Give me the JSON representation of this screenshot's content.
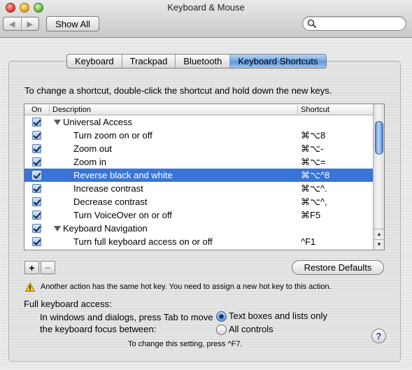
{
  "window": {
    "title": "Keyboard & Mouse"
  },
  "toolbar": {
    "back_icon": "◀",
    "forward_icon": "▶",
    "show_all_label": "Show All",
    "search_placeholder": ""
  },
  "tabs": [
    {
      "label": "Keyboard",
      "active": false
    },
    {
      "label": "Trackpad",
      "active": false
    },
    {
      "label": "Bluetooth",
      "active": false
    },
    {
      "label": "Keyboard Shortcuts",
      "active": true
    }
  ],
  "shortcuts": {
    "instructions": "To change a shortcut, double-click the shortcut and hold down the new keys.",
    "columns": {
      "on": "On",
      "description": "Description",
      "shortcut": "Shortcut"
    },
    "rows": [
      {
        "type": "group",
        "checked": true,
        "description": "Universal Access",
        "shortcut": ""
      },
      {
        "type": "item",
        "checked": true,
        "description": "Turn zoom on or off",
        "shortcut": "⌘⌥8"
      },
      {
        "type": "item",
        "checked": true,
        "description": "Zoom out",
        "shortcut": "⌘⌥-"
      },
      {
        "type": "item",
        "checked": true,
        "description": "Zoom in",
        "shortcut": "⌘⌥="
      },
      {
        "type": "item",
        "checked": true,
        "description": "Reverse black and white",
        "shortcut": "⌘⌥^8",
        "selected": true
      },
      {
        "type": "item",
        "checked": true,
        "description": "Increase contrast",
        "shortcut": "⌘⌥^."
      },
      {
        "type": "item",
        "checked": true,
        "description": "Decrease contrast",
        "shortcut": "⌘⌥^,"
      },
      {
        "type": "item",
        "checked": true,
        "description": "Turn VoiceOver on or off",
        "shortcut": "⌘F5"
      },
      {
        "type": "group",
        "checked": true,
        "description": "Keyboard Navigation",
        "shortcut": ""
      },
      {
        "type": "item",
        "checked": true,
        "description": "Turn full keyboard access on or off",
        "shortcut": "^F1"
      }
    ],
    "add_label": "+",
    "remove_label": "−",
    "restore_label": "Restore Defaults",
    "warning": "Another action has the same hot key. You need to assign a new hot key to this action."
  },
  "full_keyboard_access": {
    "label": "Full keyboard access:",
    "description": "In windows and dialogs, press Tab to move the keyboard focus between:",
    "options": [
      {
        "label": "Text boxes and lists only",
        "selected": true
      },
      {
        "label": "All controls",
        "selected": false
      }
    ],
    "footnote": "To change this setting, press ^F7."
  },
  "help_label": "?"
}
